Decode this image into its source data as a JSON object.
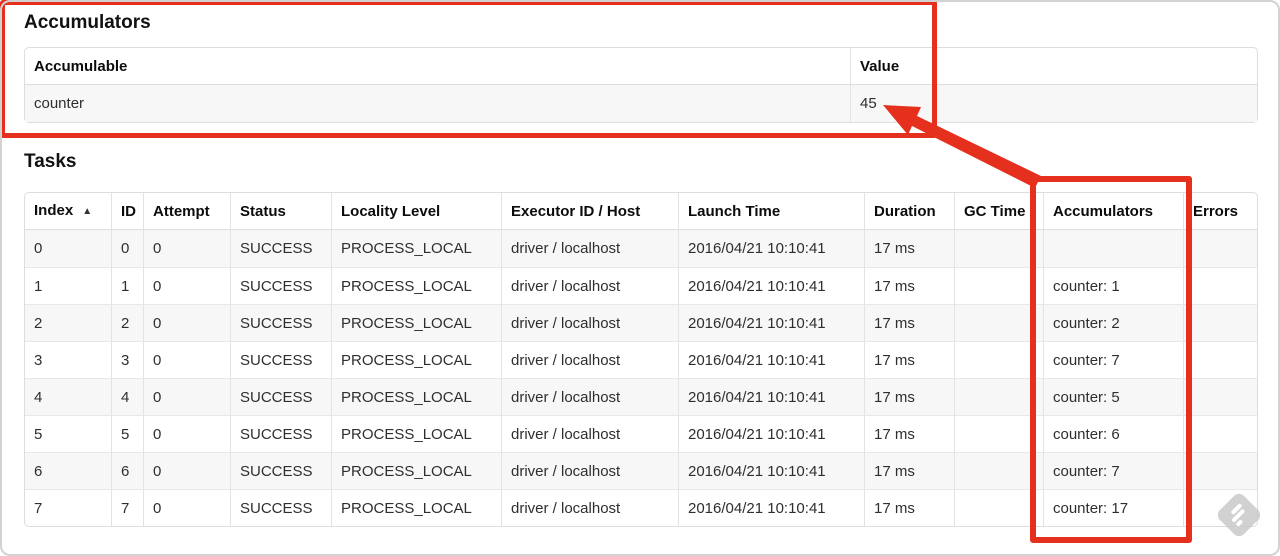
{
  "annotation": {
    "color": "#e5301d"
  },
  "accumulators_section": {
    "title": "Accumulators",
    "table": {
      "headers": {
        "accumulable": "Accumulable",
        "value": "Value"
      },
      "rows": [
        {
          "accumulable": "counter",
          "value": "45"
        }
      ]
    }
  },
  "tasks_section": {
    "title": "Tasks",
    "table": {
      "sort_icon": "▲",
      "headers": {
        "index": "Index",
        "id": "ID",
        "attempt": "Attempt",
        "status": "Status",
        "locality": "Locality Level",
        "executor": "Executor ID / Host",
        "launch": "Launch Time",
        "duration": "Duration",
        "gc": "GC Time",
        "accumulators": "Accumulators",
        "errors": "Errors"
      },
      "rows": [
        {
          "index": "0",
          "id": "0",
          "attempt": "0",
          "status": "SUCCESS",
          "locality": "PROCESS_LOCAL",
          "executor": "driver / localhost",
          "launch": "2016/04/21 10:10:41",
          "duration": "17 ms",
          "gc": "",
          "accumulators": "",
          "errors": ""
        },
        {
          "index": "1",
          "id": "1",
          "attempt": "0",
          "status": "SUCCESS",
          "locality": "PROCESS_LOCAL",
          "executor": "driver / localhost",
          "launch": "2016/04/21 10:10:41",
          "duration": "17 ms",
          "gc": "",
          "accumulators": "counter: 1",
          "errors": ""
        },
        {
          "index": "2",
          "id": "2",
          "attempt": "0",
          "status": "SUCCESS",
          "locality": "PROCESS_LOCAL",
          "executor": "driver / localhost",
          "launch": "2016/04/21 10:10:41",
          "duration": "17 ms",
          "gc": "",
          "accumulators": "counter: 2",
          "errors": ""
        },
        {
          "index": "3",
          "id": "3",
          "attempt": "0",
          "status": "SUCCESS",
          "locality": "PROCESS_LOCAL",
          "executor": "driver / localhost",
          "launch": "2016/04/21 10:10:41",
          "duration": "17 ms",
          "gc": "",
          "accumulators": "counter: 7",
          "errors": ""
        },
        {
          "index": "4",
          "id": "4",
          "attempt": "0",
          "status": "SUCCESS",
          "locality": "PROCESS_LOCAL",
          "executor": "driver / localhost",
          "launch": "2016/04/21 10:10:41",
          "duration": "17 ms",
          "gc": "",
          "accumulators": "counter: 5",
          "errors": ""
        },
        {
          "index": "5",
          "id": "5",
          "attempt": "0",
          "status": "SUCCESS",
          "locality": "PROCESS_LOCAL",
          "executor": "driver / localhost",
          "launch": "2016/04/21 10:10:41",
          "duration": "17 ms",
          "gc": "",
          "accumulators": "counter: 6",
          "errors": ""
        },
        {
          "index": "6",
          "id": "6",
          "attempt": "0",
          "status": "SUCCESS",
          "locality": "PROCESS_LOCAL",
          "executor": "driver / localhost",
          "launch": "2016/04/21 10:10:41",
          "duration": "17 ms",
          "gc": "",
          "accumulators": "counter: 7",
          "errors": ""
        },
        {
          "index": "7",
          "id": "7",
          "attempt": "0",
          "status": "SUCCESS",
          "locality": "PROCESS_LOCAL",
          "executor": "driver / localhost",
          "launch": "2016/04/21 10:10:41",
          "duration": "17 ms",
          "gc": "",
          "accumulators": "counter: 17",
          "errors": ""
        }
      ]
    }
  }
}
